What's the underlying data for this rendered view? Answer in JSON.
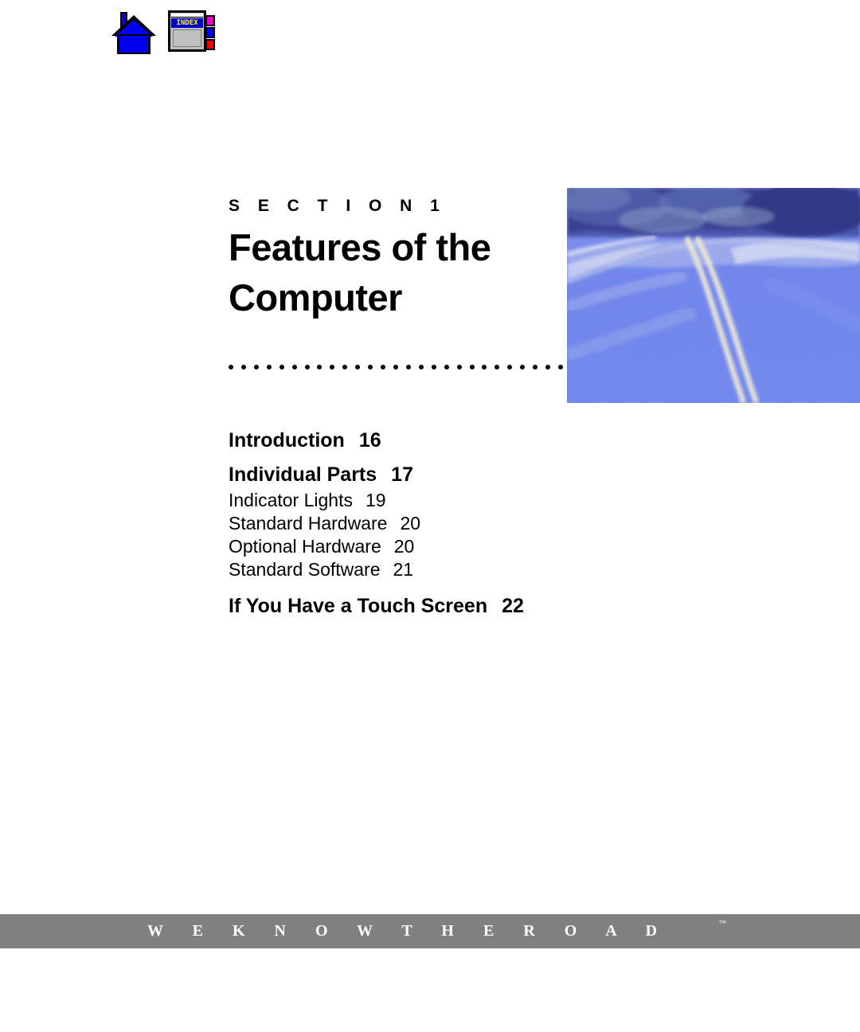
{
  "nav": {
    "home_icon": "home-icon",
    "index_icon": "index-icon",
    "index_label": "INDEX"
  },
  "title_block": {
    "eyebrow": "S E C T I O N   1",
    "title_line_1": "Features of the",
    "title_line_2": "Computer"
  },
  "hero": {
    "image_name": "winding-road-photo",
    "alt": "Blue-toned photograph of a winding two-lane road through trees"
  },
  "divider": {
    "style": "dotted",
    "dot_count": 27,
    "color": "#000000"
  },
  "toc": {
    "entries": [
      {
        "label": "Introduction",
        "page": "16",
        "level": "major"
      },
      {
        "label": "Individual Parts",
        "page": "17",
        "level": "major"
      },
      {
        "label": "Indicator Lights",
        "page": "19",
        "level": "minor"
      },
      {
        "label": "Standard Hardware",
        "page": "20",
        "level": "minor"
      },
      {
        "label": "Optional Hardware",
        "page": "20",
        "level": "minor"
      },
      {
        "label": "Standard Software",
        "page": "21",
        "level": "minor"
      },
      {
        "label": "If You Have a Touch Screen",
        "page": "22",
        "level": "major"
      }
    ]
  },
  "footer": {
    "tagline": "W E K N O W T H E R O A D",
    "trademark": "™",
    "bar_color": "#808080",
    "text_color": "#ffffff"
  }
}
